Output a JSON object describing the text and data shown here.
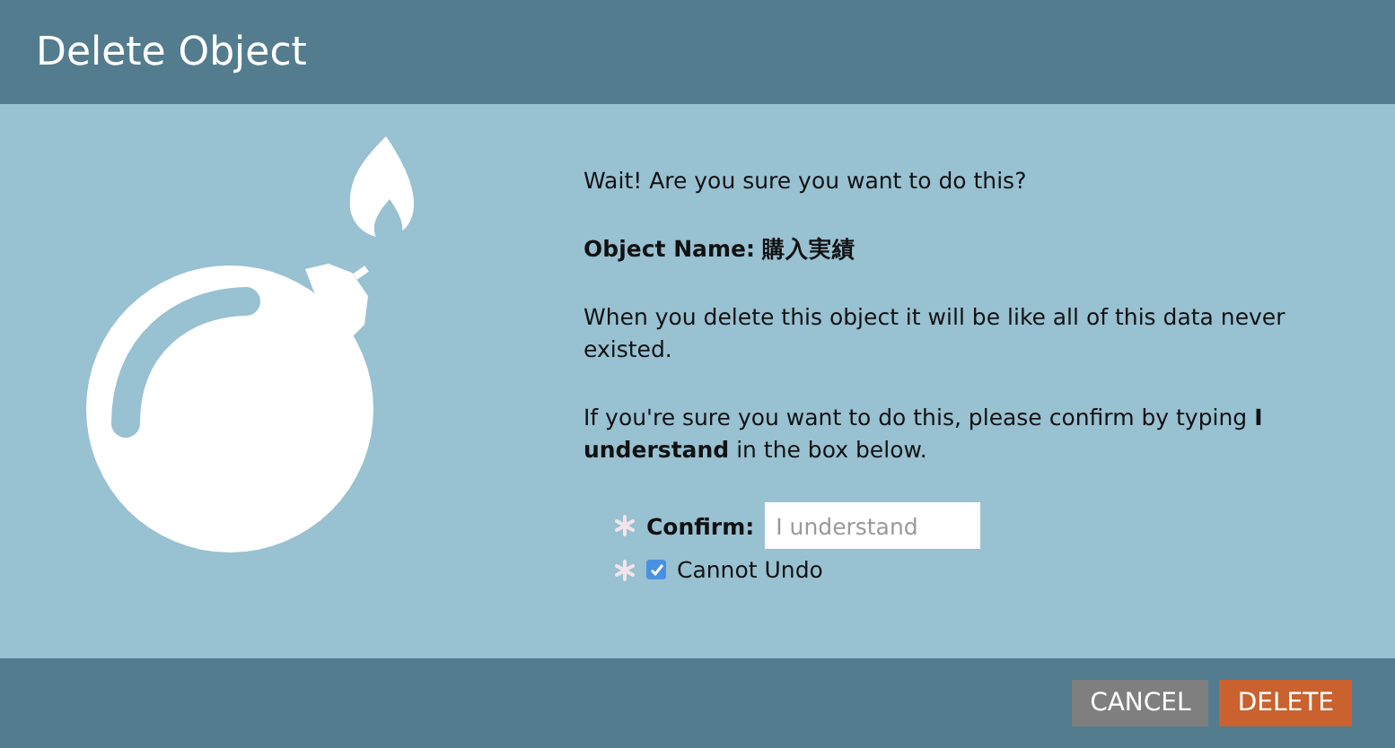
{
  "window": {
    "title": "Delete Object"
  },
  "intro": "Wait! Are you sure you want to do this?",
  "object_name": {
    "label": "Object Name:",
    "value": "購入実績"
  },
  "warning": "When you delete this object it will be like all of this data never existed.",
  "instruction": "If you're sure you want to do this, please confirm by typing **I understand** in the box below.",
  "fields": [
    {
      "kind": "text",
      "required": true,
      "label": "Confirm:",
      "placeholder": "I understand"
    },
    {
      "kind": "checkbox",
      "required": true,
      "label": "Cannot Undo",
      "checked": true
    }
  ],
  "buttons": [
    {
      "label": "CANCEL",
      "kind": "secondary"
    },
    {
      "label": "DELETE",
      "kind": "danger"
    }
  ]
}
